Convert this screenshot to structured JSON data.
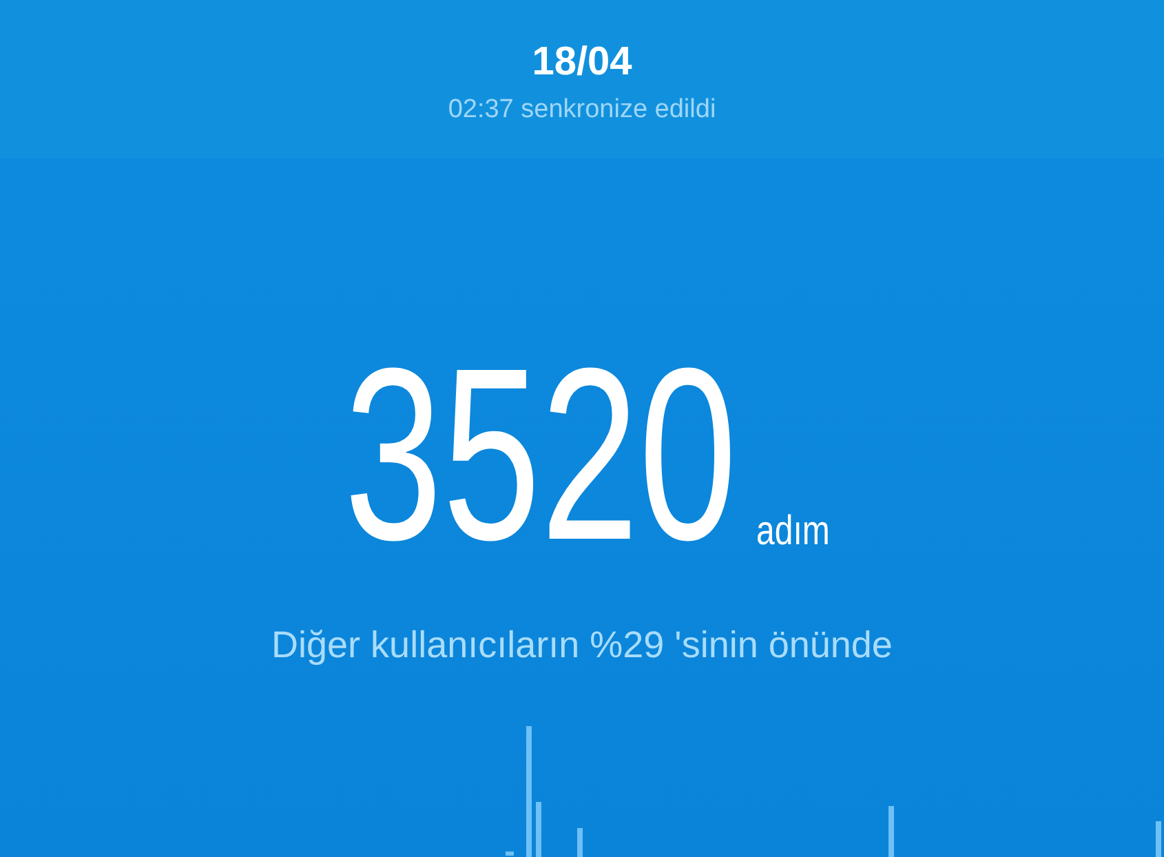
{
  "header": {
    "date": "18/04",
    "sync_status": "02:37 senkronize edildi"
  },
  "steps": {
    "count": "3520",
    "unit": "adım",
    "comparison": "Diğer kullanıcıların %29 'sinin önünde"
  }
}
